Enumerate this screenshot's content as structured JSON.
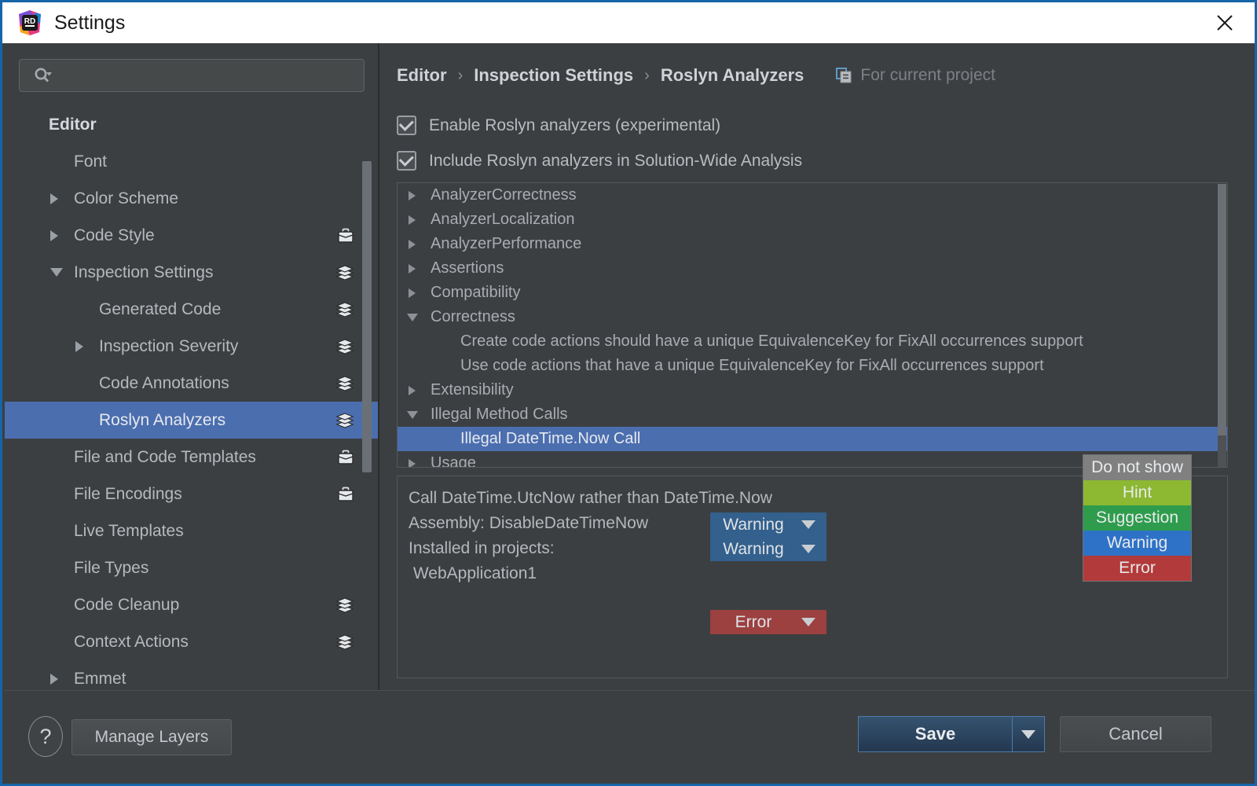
{
  "window": {
    "title": "Settings",
    "logo_icon": "rider-logo-icon",
    "close_icon": "close-icon"
  },
  "search": {
    "placeholder": "",
    "value": "",
    "icon": "search-icon"
  },
  "sidebar": {
    "items": [
      {
        "label": "Editor",
        "indent": 0,
        "arrow": "none",
        "badge": "none",
        "selected": false
      },
      {
        "label": "Font",
        "indent": 1,
        "arrow": "none",
        "badge": "none",
        "selected": false
      },
      {
        "label": "Color Scheme",
        "indent": 1,
        "arrow": "right",
        "badge": "none",
        "selected": false
      },
      {
        "label": "Code Style",
        "indent": 1,
        "arrow": "right",
        "badge": "briefcase",
        "selected": false
      },
      {
        "label": "Inspection Settings",
        "indent": 1,
        "arrow": "down",
        "badge": "layers",
        "selected": false
      },
      {
        "label": "Generated Code",
        "indent": 2,
        "arrow": "none",
        "badge": "layers",
        "selected": false
      },
      {
        "label": "Inspection Severity",
        "indent": 2,
        "arrow": "right",
        "badge": "layers",
        "selected": false
      },
      {
        "label": "Code Annotations",
        "indent": 2,
        "arrow": "none",
        "badge": "layers",
        "selected": false
      },
      {
        "label": "Roslyn Analyzers",
        "indent": 2,
        "arrow": "none",
        "badge": "layers",
        "selected": true
      },
      {
        "label": "File and Code Templates",
        "indent": 1,
        "arrow": "none",
        "badge": "briefcase",
        "selected": false
      },
      {
        "label": "File Encodings",
        "indent": 1,
        "arrow": "none",
        "badge": "briefcase",
        "selected": false
      },
      {
        "label": "Live Templates",
        "indent": 1,
        "arrow": "none",
        "badge": "none",
        "selected": false
      },
      {
        "label": "File Types",
        "indent": 1,
        "arrow": "none",
        "badge": "none",
        "selected": false
      },
      {
        "label": "Code Cleanup",
        "indent": 1,
        "arrow": "none",
        "badge": "layers",
        "selected": false
      },
      {
        "label": "Context Actions",
        "indent": 1,
        "arrow": "none",
        "badge": "layers",
        "selected": false
      },
      {
        "label": "Emmet",
        "indent": 1,
        "arrow": "right",
        "badge": "none",
        "selected": false
      }
    ]
  },
  "breadcrumb": {
    "items": [
      "Editor",
      "Inspection Settings",
      "Roslyn Analyzers"
    ],
    "separator": "›",
    "scope_label": "For current project",
    "scope_icon": "copy-icon"
  },
  "options": [
    {
      "label": "Enable Roslyn analyzers (experimental)",
      "checked": true
    },
    {
      "label": "Include Roslyn analyzers in Solution-Wide Analysis",
      "checked": true
    }
  ],
  "analyzer_tree": [
    {
      "label": "AnalyzerCorrectness",
      "arrow": "right",
      "level": 0,
      "selected": false,
      "severity": null
    },
    {
      "label": "AnalyzerLocalization",
      "arrow": "right",
      "level": 0,
      "selected": false,
      "severity": null
    },
    {
      "label": "AnalyzerPerformance",
      "arrow": "right",
      "level": 0,
      "selected": false,
      "severity": null
    },
    {
      "label": "Assertions",
      "arrow": "right",
      "level": 0,
      "selected": false,
      "severity": null
    },
    {
      "label": "Compatibility",
      "arrow": "right",
      "level": 0,
      "selected": false,
      "severity": null
    },
    {
      "label": "Correctness",
      "arrow": "down",
      "level": 0,
      "selected": false,
      "severity": null
    },
    {
      "label": "Create code actions should have a unique EquivalenceKey for FixAll occurrences support",
      "arrow": "none",
      "level": 1,
      "selected": false,
      "severity": "Warning"
    },
    {
      "label": "Use code actions that have a unique EquivalenceKey for FixAll occurrences support",
      "arrow": "none",
      "level": 1,
      "selected": false,
      "severity": "Warning"
    },
    {
      "label": "Extensibility",
      "arrow": "right",
      "level": 0,
      "selected": false,
      "severity": null
    },
    {
      "label": "Illegal Method Calls",
      "arrow": "down",
      "level": 0,
      "selected": false,
      "severity": null
    },
    {
      "label": "Illegal DateTime.Now Call",
      "arrow": "none",
      "level": 1,
      "selected": true,
      "severity": "Error"
    },
    {
      "label": "Usage",
      "arrow": "right",
      "level": 0,
      "selected": false,
      "severity": null
    }
  ],
  "severity_dropdown": {
    "open": true,
    "options": [
      {
        "label": "Do not show",
        "color": "#808080"
      },
      {
        "label": "Hint",
        "color": "#8cb832"
      },
      {
        "label": "Suggestion",
        "color": "#2e9c4c"
      },
      {
        "label": "Warning",
        "color": "#2e72c8"
      },
      {
        "label": "Error",
        "color": "#b33a3a"
      }
    ]
  },
  "description": {
    "lines": [
      "Call DateTime.UtcNow rather than DateTime.Now",
      "Assembly: DisableDateTimeNow",
      "Installed in projects:",
      " WebApplication1"
    ]
  },
  "footer": {
    "help_label": "?",
    "manage_layers_label": "Manage Layers",
    "save_label": "Save",
    "save_dropdown_icon": "chevron-down-icon",
    "cancel_label": "Cancel"
  },
  "colors": {
    "accent_blue": "#4b6eaf",
    "combo_blue": "#33608c",
    "combo_red": "#9c4040",
    "window_border": "#1565a8",
    "background": "#3c3f41"
  }
}
